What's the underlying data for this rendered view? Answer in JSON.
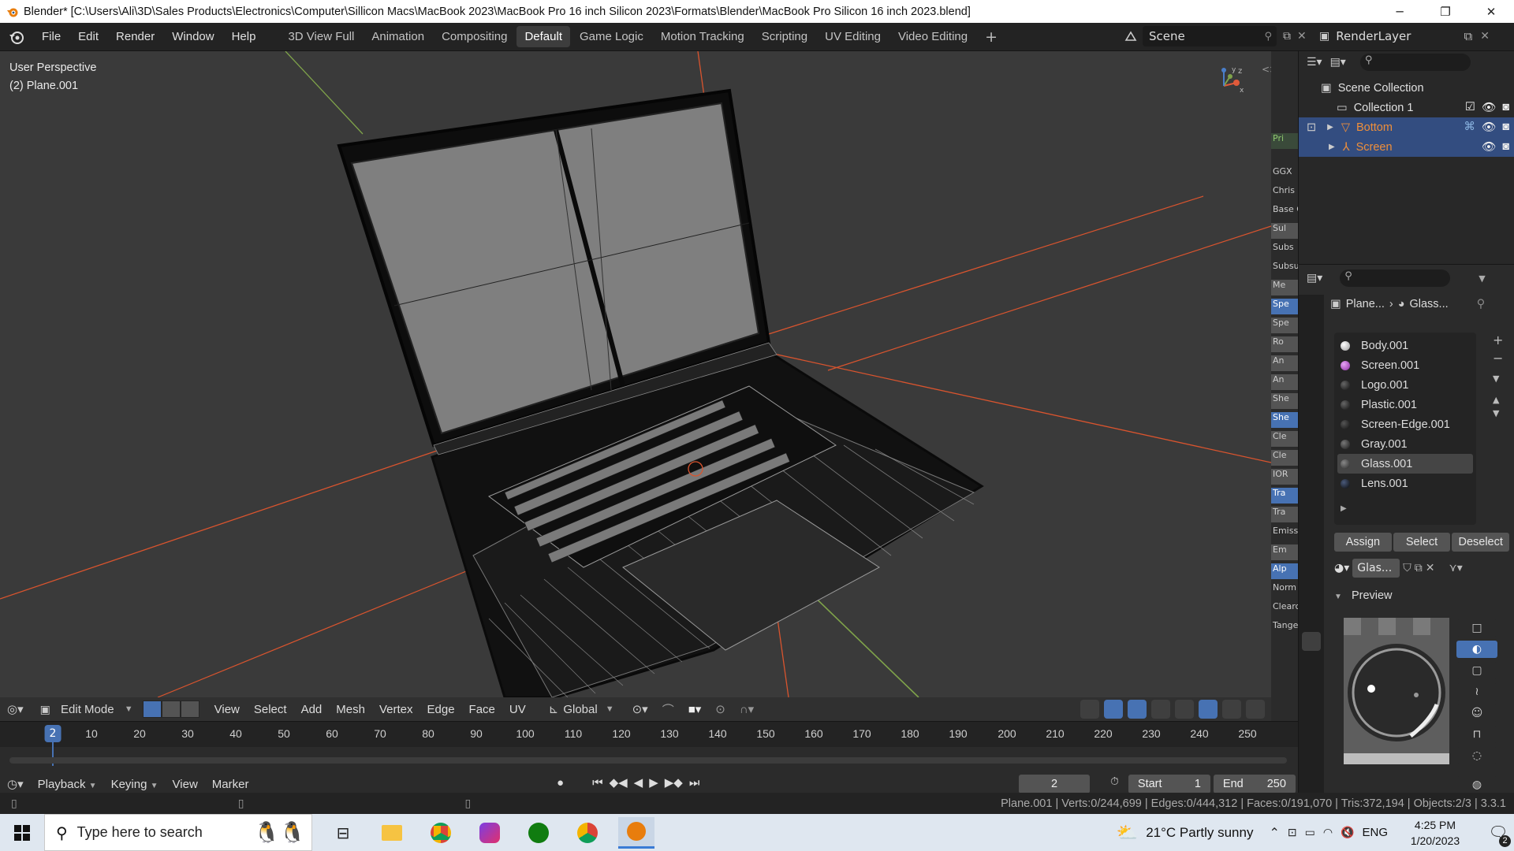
{
  "window": {
    "title": "Blender* [C:\\Users\\Ali\\3D\\Sales Products\\Electronics\\Computer\\Sillicon Macs\\MacBook 2023\\MacBook Pro 16 inch Silicon 2023\\Formats\\Blender\\MacBook Pro Silicon 16 inch 2023.blend]",
    "minimize": "─",
    "restore": "❐",
    "close": "✕"
  },
  "topbar": {
    "menus": [
      "File",
      "Edit",
      "Render",
      "Window",
      "Help"
    ],
    "workspaces": [
      "3D View Full",
      "Animation",
      "Compositing",
      "Default",
      "Game Logic",
      "Motion Tracking",
      "Scripting",
      "UV Editing",
      "Video Editing"
    ],
    "active_workspace": "Default",
    "add_workspace": "+",
    "scene": "Scene",
    "render_layer": "RenderLayer"
  },
  "viewport": {
    "perspective": "User Perspective",
    "object_info": "(2) Plane.001",
    "gizmo_axes": [
      "x",
      "y",
      "z"
    ],
    "header": {
      "mode": "Edit Mode",
      "menus": [
        "View",
        "Select",
        "Add",
        "Mesh",
        "Vertex",
        "Edge",
        "Face",
        "UV"
      ],
      "orientation": "Global"
    }
  },
  "strip_labels": [
    "Pri",
    "GGX",
    "Chris",
    "Base C",
    "Sul",
    "Subs",
    "Subsu",
    "Me",
    "Spe",
    "Spe",
    "Ro",
    "An",
    "An",
    "She",
    "She",
    "Cle",
    "Cle",
    "IOR",
    "Tra",
    "Tra",
    "Emiss",
    "Em",
    "Alp",
    "Norm",
    "Clearc",
    "Tange"
  ],
  "outliner": {
    "root": "Scene Collection",
    "collection": "Collection 1",
    "objects": [
      "Bottom",
      "Screen"
    ]
  },
  "properties": {
    "breadcrumb_object": "Plane...",
    "breadcrumb_material": "Glass...",
    "materials": [
      {
        "name": "Body.001",
        "color": "#cfcfcf"
      },
      {
        "name": "Screen.001",
        "color": "#b44fc9"
      },
      {
        "name": "Logo.001",
        "color": "#1a1a1a"
      },
      {
        "name": "Plastic.001",
        "color": "#1a1a1a"
      },
      {
        "name": "Screen-Edge.001",
        "color": "#1a1a1a"
      },
      {
        "name": "Gray.001",
        "color": "#202020"
      },
      {
        "name": "Glass.001",
        "color": "#3a3a3a"
      },
      {
        "name": "Lens.001",
        "color": "#141414"
      }
    ],
    "selected_material": "Glass.001",
    "buttons": {
      "assign": "Assign",
      "select": "Select",
      "deselect": "Deselect"
    },
    "slot_name": "Glas...",
    "preview_label": "Preview"
  },
  "timeline": {
    "current_frame": "2",
    "ticks": [
      "10",
      "20",
      "30",
      "40",
      "50",
      "60",
      "70",
      "80",
      "90",
      "100",
      "110",
      "120",
      "130",
      "140",
      "150",
      "160",
      "170",
      "180",
      "190",
      "200",
      "210",
      "220",
      "230",
      "240",
      "250"
    ],
    "menus": [
      "Playback",
      "Keying",
      "View",
      "Marker"
    ],
    "frame_field": "2",
    "start_label": "Start",
    "start_value": "1",
    "end_label": "End",
    "end_value": "250"
  },
  "statusbar": {
    "stats": "Plane.001 | Verts:0/244,699 | Edges:0/444,312 | Faces:0/191,070 | Tris:372,194 | Objects:2/3 | 3.3.1"
  },
  "taskbar": {
    "search_placeholder": "Type here to search",
    "weather": "21°C  Partly sunny",
    "language": "ENG",
    "time": "4:25 PM",
    "date": "1/20/2023",
    "notifications": "2"
  },
  "colors": {
    "accent": "#4772b3",
    "object_orange": "#ef8f3a",
    "viewport_bg": "#3a3a3a",
    "x_axis": "#e05a3a",
    "y_axis": "#7fa34a"
  }
}
